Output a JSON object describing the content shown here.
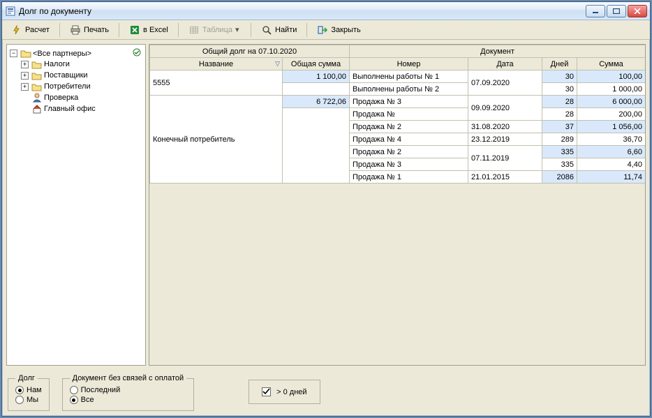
{
  "window": {
    "title": "Долг по документу"
  },
  "toolbar": {
    "calc": "Расчет",
    "print": "Печать",
    "excel": "в Excel",
    "table": "Таблица",
    "find": "Найти",
    "close": "Закрыть"
  },
  "tree": {
    "root": "<Все партнеры>",
    "items": [
      {
        "label": "Налоги"
      },
      {
        "label": "Поставщики"
      },
      {
        "label": "Потребители"
      },
      {
        "label": "Проверка",
        "icon": "person"
      },
      {
        "label": "Главный офис",
        "icon": "home"
      }
    ]
  },
  "grid": {
    "header_group_left": "Общий долг на 07.10.2020",
    "header_group_right": "Документ",
    "cols": {
      "name": "Название",
      "total": "Общая сумма",
      "number": "Номер",
      "date": "Дата",
      "days": "Дней",
      "sum": "Сумма"
    },
    "groups": [
      {
        "name": "5555",
        "total": "1 100,00",
        "rows": [
          {
            "number": "Выполнены работы № 1",
            "date": "07.09.2020",
            "date_rowspan": 2,
            "days": "30",
            "sum": "100,00",
            "hl": true
          },
          {
            "number": "Выполнены работы № 2",
            "days": "30",
            "sum": "1 000,00"
          }
        ]
      },
      {
        "name": "Конечный потребитель",
        "total": "6 722,06",
        "rows": [
          {
            "number": "Продажа № 3",
            "date": "09.09.2020",
            "date_rowspan": 2,
            "days": "28",
            "sum": "6 000,00",
            "hl": true
          },
          {
            "number": "Продажа №",
            "days": "28",
            "sum": "200,00"
          },
          {
            "number": "Продажа № 2",
            "date": "31.08.2020",
            "days": "37",
            "sum": "1 056,00",
            "hl": true
          },
          {
            "number": "Продажа № 4",
            "date": "23.12.2019",
            "days": "289",
            "sum": "36,70"
          },
          {
            "number": "Продажа № 2",
            "date": "07.11.2019",
            "date_rowspan": 2,
            "days": "335",
            "sum": "6,60",
            "hl": true
          },
          {
            "number": "Продажа № 3",
            "days": "335",
            "sum": "4,40"
          },
          {
            "number": "Продажа № 1",
            "date": "21.01.2015",
            "days": "2086",
            "sum": "11,74",
            "hl": true
          }
        ]
      }
    ]
  },
  "bottom": {
    "debt_legend": "Долг",
    "debt_us": "Нам",
    "debt_we": "Мы",
    "doc_legend": "Документ без связей с оплатой",
    "doc_last": "Последний",
    "doc_all": "Все",
    "days_filter": "> 0 дней"
  }
}
